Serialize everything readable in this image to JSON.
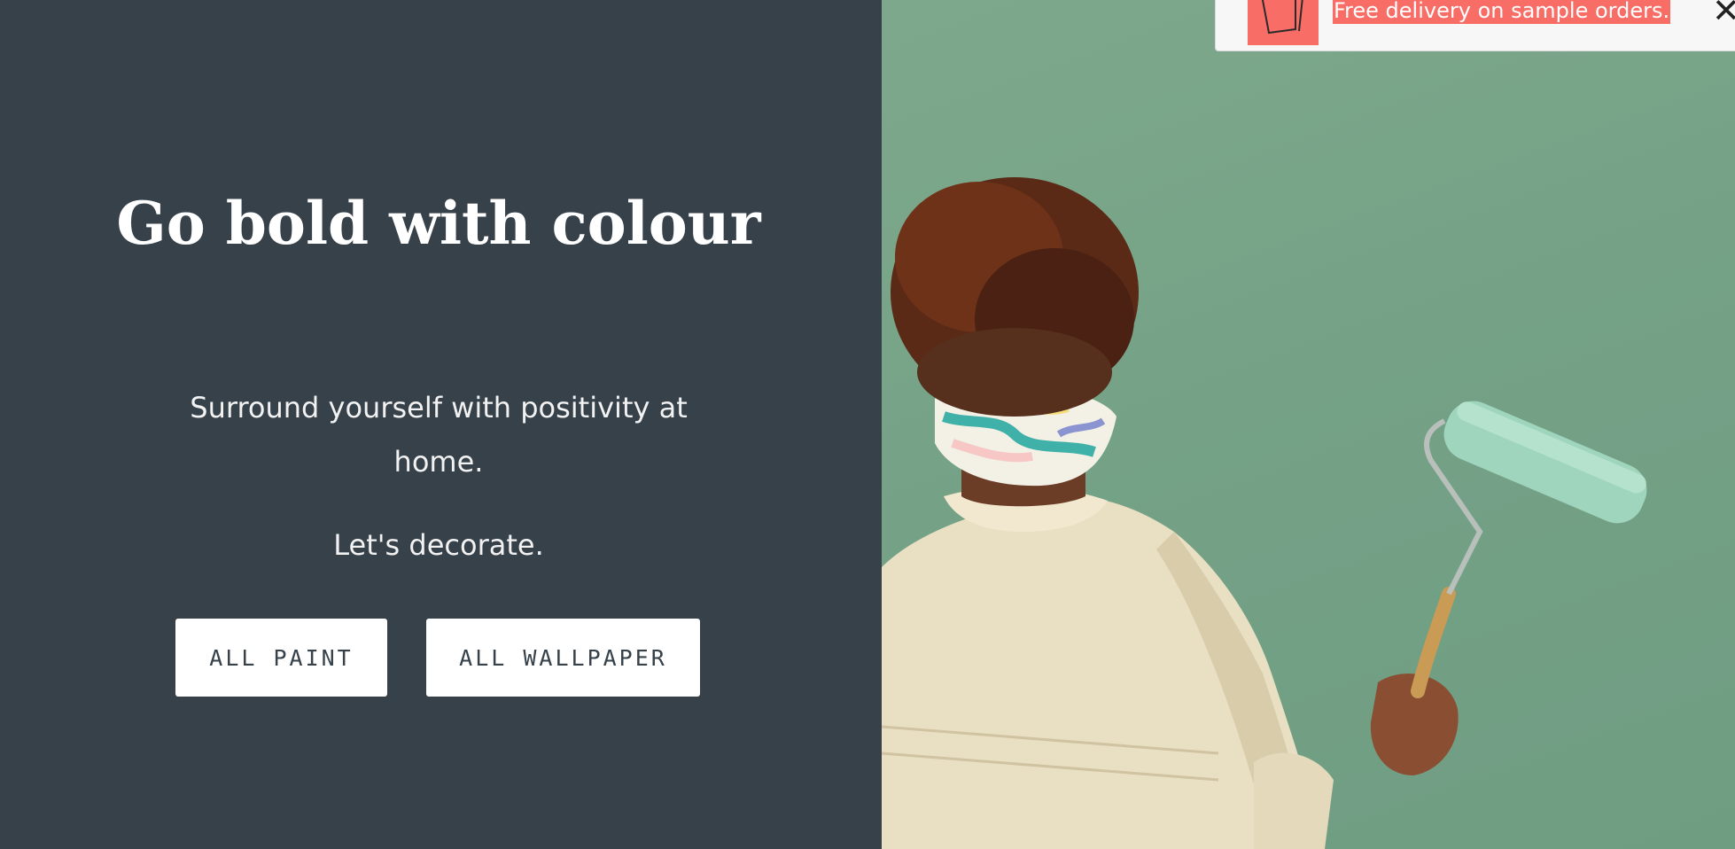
{
  "hero": {
    "headline": "Go bold with colour",
    "subtext": "Surround yourself with positivity at home.",
    "cta_text": "Let's decorate.",
    "buttons": {
      "paint_label": "ALL PAINT",
      "wallpaper_label": "ALL WALLPAPER"
    },
    "image_description_icon": "painter-with-roller-photo"
  },
  "promo": {
    "text": "Free delivery on sample orders.",
    "icon": "swatch-icon",
    "close_icon": "close-icon"
  },
  "colors": {
    "panel_background": "#36414a",
    "wall_green": "#75a287",
    "promo_accent": "#f86d66",
    "button_background": "#ffffff"
  }
}
